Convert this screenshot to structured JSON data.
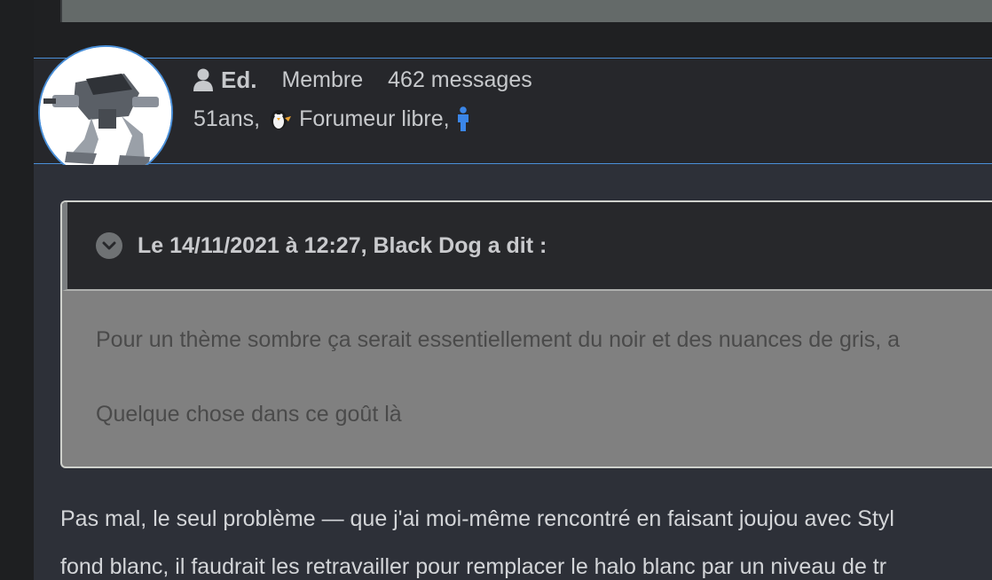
{
  "author": {
    "name": "Ed.",
    "role": "Membre",
    "messages": "462 messages",
    "age": "51ans,",
    "tagline": "Forumeur libre,",
    "icons": [
      "user-icon",
      "tux-penguin-icon",
      "male-person-icon"
    ]
  },
  "quote": {
    "title": "Le 14/11/2021 à 12:27, Black Dog a dit :",
    "lines": [
      "Pour un thème sombre ça serait essentiellement du noir et des nuances de gris, a",
      "Quelque chose dans ce goût là"
    ]
  },
  "post": {
    "lines": [
      "Pas mal, le seul problème — que j'ai moi-même rencontré en faisant joujou avec Styl",
      "fond blanc, il faudrait les retravailler pour remplacer le halo blanc par un niveau de tr"
    ]
  },
  "colors": {
    "accent": "#4a8fd8",
    "page_bg": "#2d3038",
    "quote_bg": "#808080",
    "quote_header_bg": "#27282b"
  }
}
